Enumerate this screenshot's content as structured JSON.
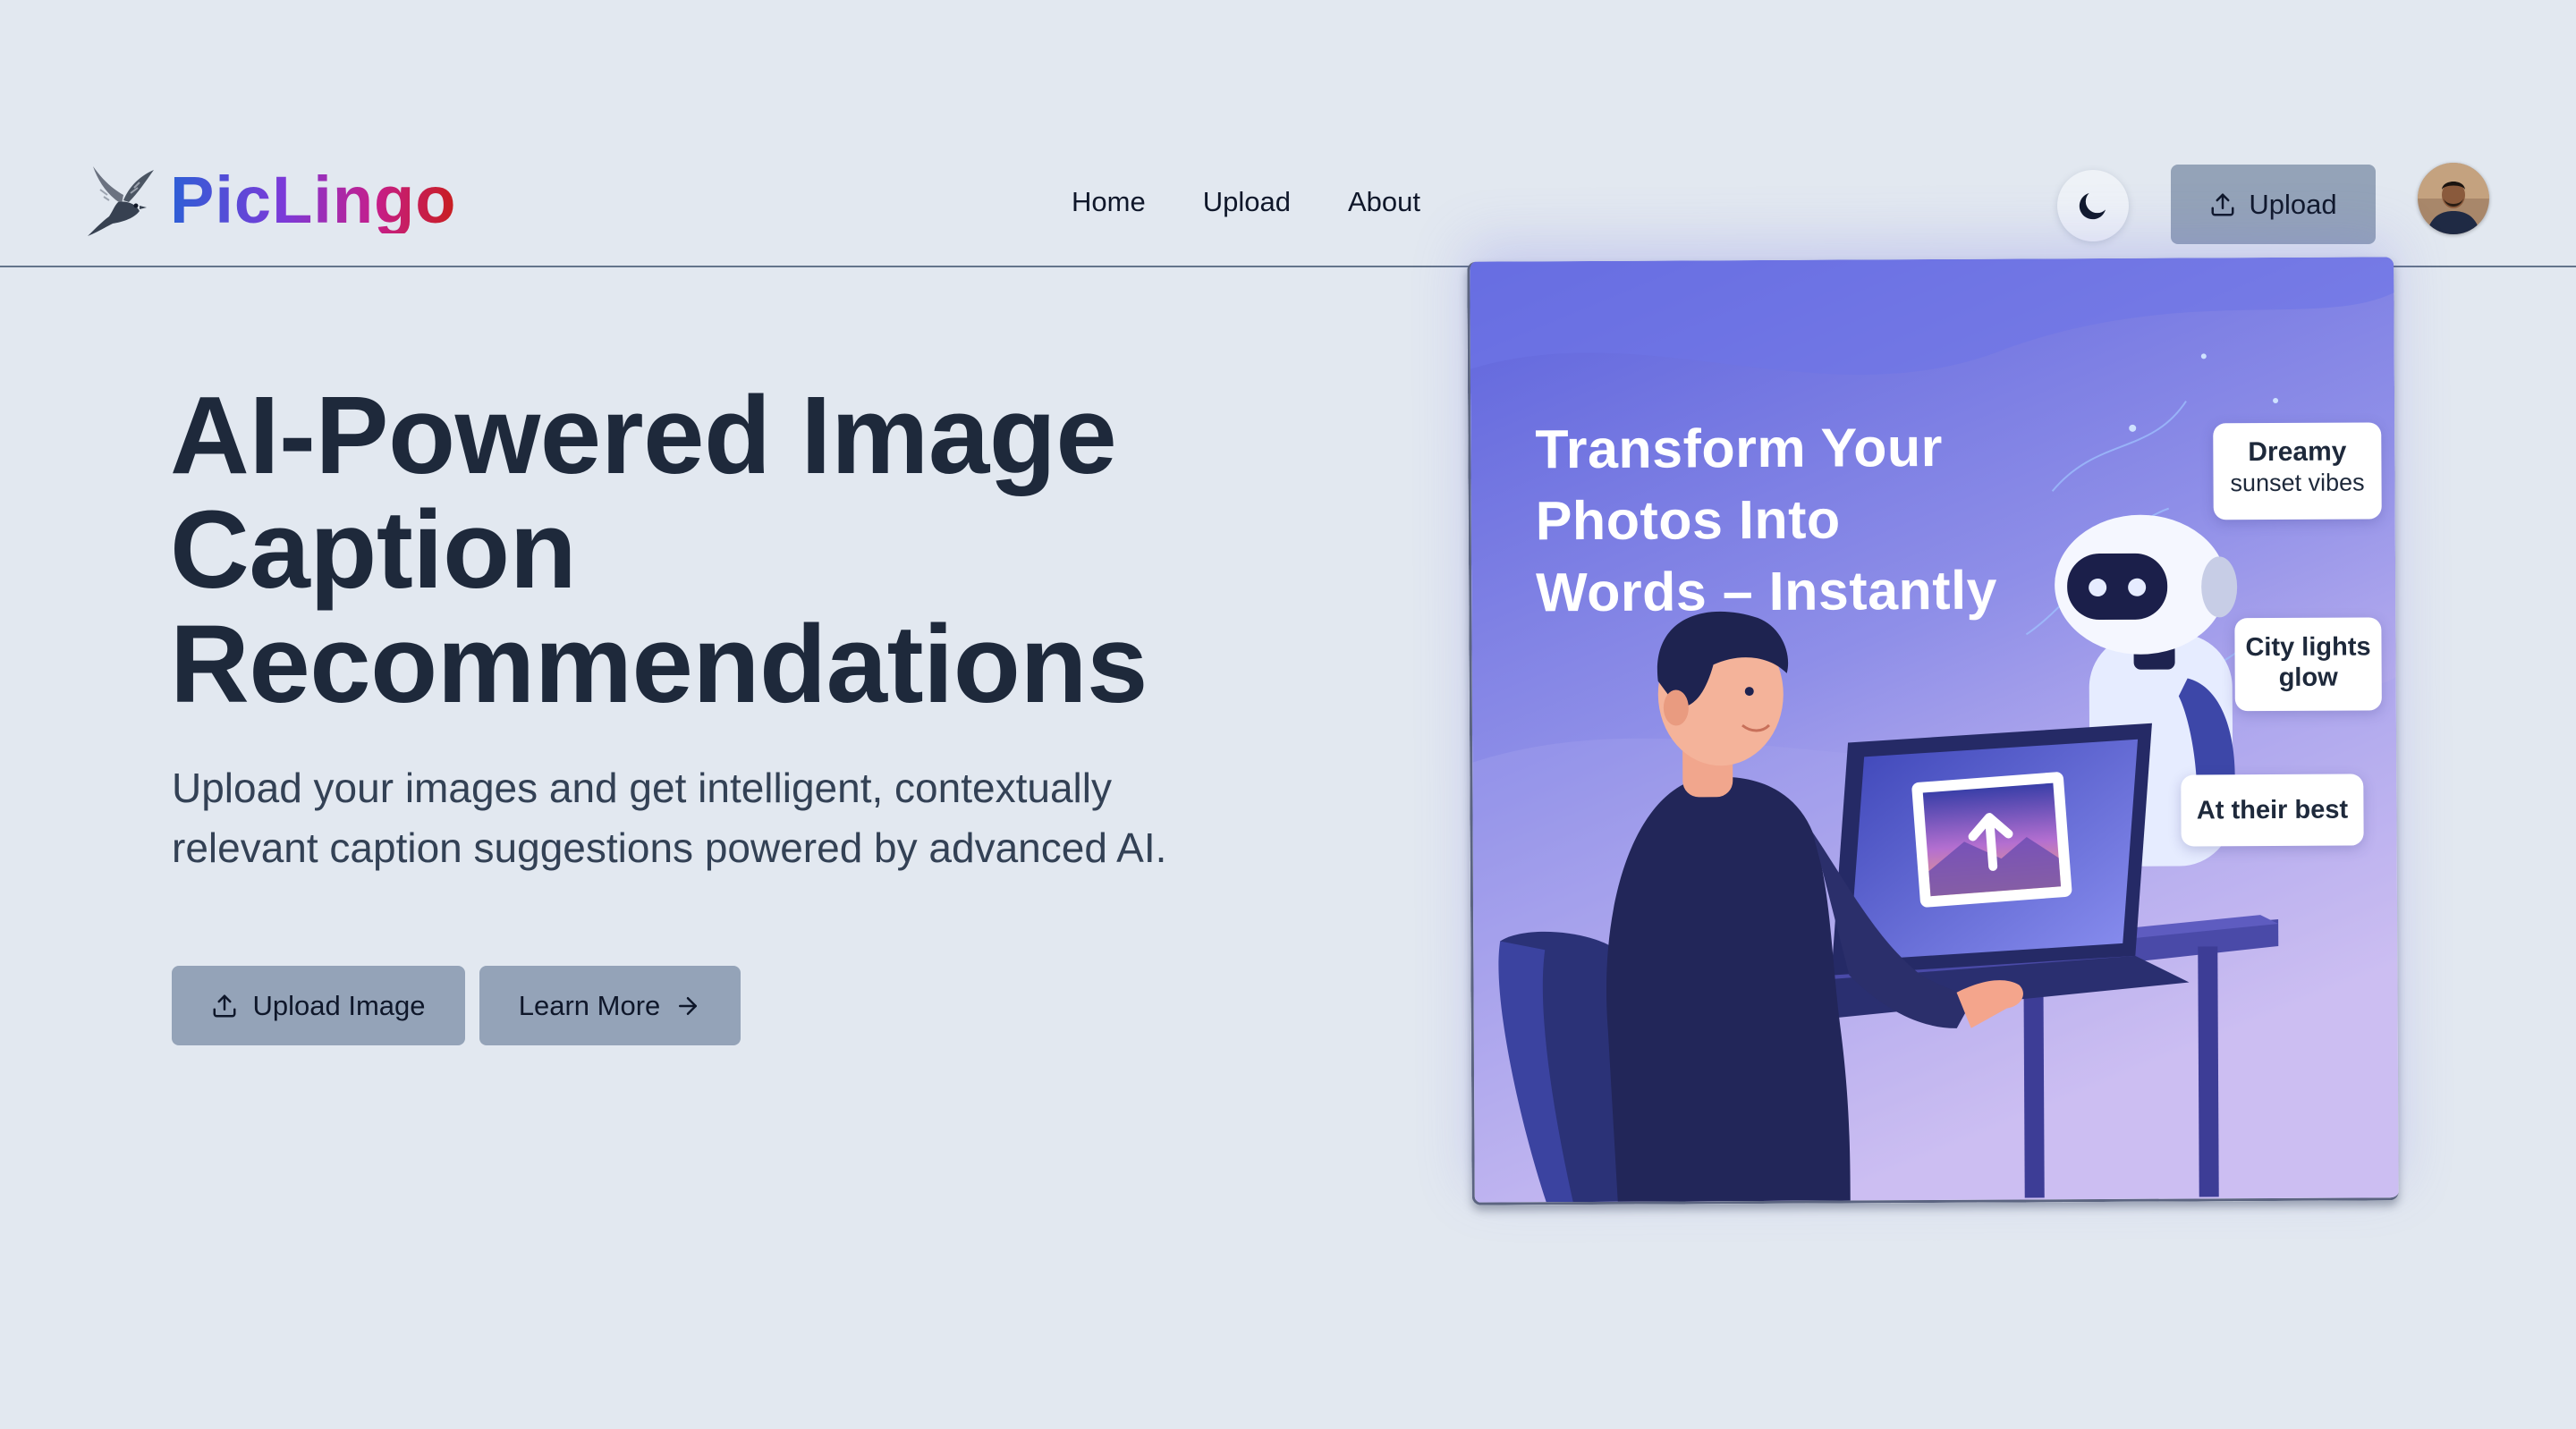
{
  "brand": {
    "name": "PicLingo"
  },
  "nav": {
    "links": [
      "Home",
      "Upload",
      "About"
    ],
    "upload_label": "Upload"
  },
  "hero": {
    "title_lines": [
      "AI-Powered Image",
      "Caption",
      "Recommendations"
    ],
    "subtitle": "Upload your images and get intelligent, contextually relevant caption suggestions powered by advanced AI.",
    "upload_button": "Upload Image",
    "learn_button": "Learn More"
  },
  "illustration": {
    "title_lines": [
      "Transform Your",
      "Photos Into",
      "Words – Instantly"
    ],
    "bubbles": [
      {
        "line1": "Dreamy",
        "line2": "sunset vibes"
      },
      {
        "line1": "City lights",
        "line2": "glow"
      },
      {
        "line1": "At their best",
        "line2": ""
      }
    ]
  },
  "icons": {
    "logo": "bird-logo-icon",
    "theme": "moon-icon",
    "upload": "upload-icon",
    "arrow": "arrow-right-icon"
  },
  "colors": {
    "page_bg": "#e2e8f0",
    "button_bg": "#94a3b8",
    "heading": "#1e293b",
    "illustration_bg_top": "#6a6fe0",
    "illustration_bg_bottom": "#dcc9f3"
  }
}
